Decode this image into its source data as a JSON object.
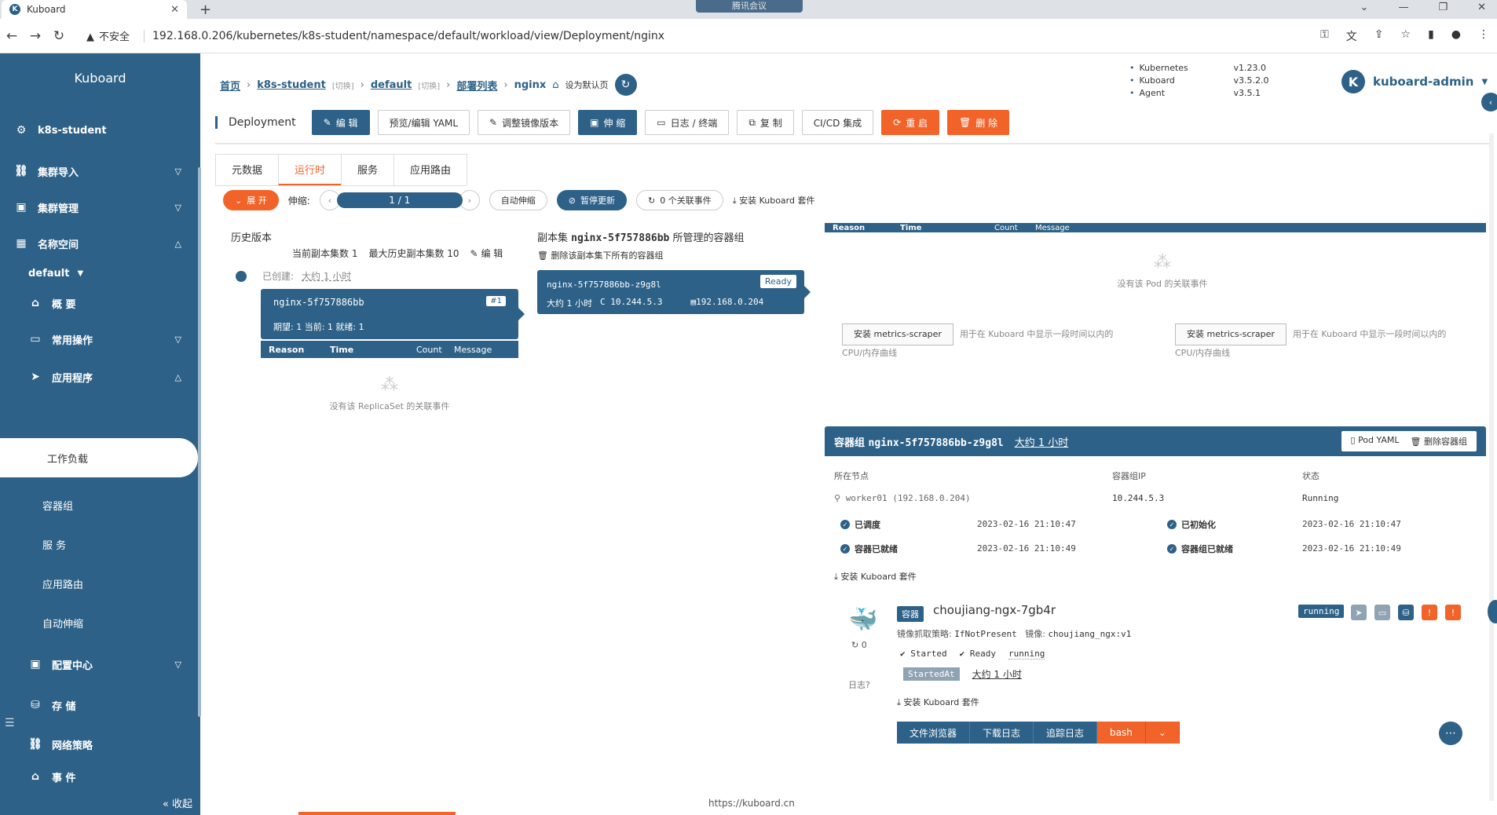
{
  "browser": {
    "tab_title": "Kuboard",
    "tab_favicon": "K",
    "meeting_label": "腾讯会议",
    "insecure_label": "不安全",
    "url": "192.168.0.206/kubernetes/k8s-student/namespace/default/workload/view/Deployment/nginx"
  },
  "sidebar": {
    "brand": "Kuboard",
    "cluster": "k8s-student",
    "items": {
      "import": "集群导入",
      "manage": "集群管理",
      "namespace": "名称空间",
      "ns_value": "default",
      "overview": "概 要",
      "common": "常用操作",
      "apps": "应用程序",
      "workload": "工作负载",
      "pods": "容器组",
      "services": "服 务",
      "ingress": "应用路由",
      "autoscale": "自动伸缩",
      "config": "配置中心",
      "storage": "存 储",
      "netpolicy": "网络策略",
      "events": "事 件"
    },
    "collapse": "« 收起"
  },
  "header": {
    "breadcrumb": {
      "home": "首页",
      "cluster": "k8s-student",
      "cluster_tag": "[切换]",
      "namespace": "default",
      "ns_tag": "[切换]",
      "deploy_list": "部署列表",
      "current": "nginx",
      "set_default": "设为默认页"
    },
    "versions": [
      {
        "k": "Kubernetes",
        "v": "v1.23.0"
      },
      {
        "k": "Kuboard",
        "v": "v3.5.2.0"
      },
      {
        "k": "Agent",
        "v": "v3.5.1"
      }
    ],
    "user": {
      "avatar": "K",
      "name": "kuboard-admin"
    }
  },
  "toolbar": {
    "kind": "Deployment",
    "edit": "编 辑",
    "yaml": "预览/编辑 YAML",
    "image": "调整镜像版本",
    "scale": "伸 缩",
    "logs": "日志 / 终端",
    "copy": "复 制",
    "cicd": "CI/CD 集成",
    "restart": "重 启",
    "delete": "删 除"
  },
  "tabs": [
    "元数据",
    "运行时",
    "服务",
    "应用路由"
  ],
  "runtime": {
    "expand": "展 开",
    "scale_label": "伸缩:",
    "scale_value": "1 / 1",
    "autoscale": "自动伸缩",
    "pause": "暂停更新",
    "events": "0 个关联事件",
    "install": "安装 Kuboard 套件"
  },
  "history": {
    "title": "历史版本",
    "current_replicas": "当前副本集数 1",
    "max_history": "最大历史副本集数 10",
    "edit": "编 辑",
    "created_label": "已创建:",
    "created_value": "大约 1 小时",
    "rs_name": "nginx-5f757886bb",
    "rs_badge": "#1",
    "rs_stats": "期望: 1  当前: 1  就绪: 1",
    "ev_cols": [
      "Reason",
      "Time",
      "Count",
      "Message"
    ],
    "empty": "没有该 ReplicaSet 的关联事件"
  },
  "podset": {
    "title_prefix": "副本集",
    "title_name": "nginx-5f757886bb",
    "title_suffix": "所管理的容器组",
    "delete_all": "删除该副本集下所有的容器组",
    "pod_name": "nginx-5f757886bb-z9g8l",
    "pod_ready": "Ready",
    "pod_age": "大约 1 小时",
    "pod_ip": "C 10.244.5.3",
    "host_ip": "192.168.0.204"
  },
  "pod_events": {
    "cols": [
      "Reason",
      "Time",
      "Count",
      "Message"
    ],
    "empty": "没有该 Pod 的关联事件",
    "metric_btn": "安装 metrics-scraper",
    "metric_desc": "用于在 Kuboard 中显示一段时间以内的CPU/内存曲线"
  },
  "pod": {
    "label": "容器组",
    "name": "nginx-5f757886bb-z9g8l",
    "age": "大约 1 小时",
    "yaml": "Pod YAML",
    "delete": "删除容器组",
    "node_label": "所在节点",
    "node_value": "worker01 (192.168.0.204)",
    "ip_label": "容器组IP",
    "ip_value": "10.244.5.3",
    "status_label": "状态",
    "status_value": "Running",
    "conditions": [
      {
        "name": "已调度",
        "time": "2023-02-16 21:10:47"
      },
      {
        "name": "已初始化",
        "time": "2023-02-16 21:10:47"
      },
      {
        "name": "容器已就绪",
        "time": "2023-02-16 21:10:49"
      },
      {
        "name": "容器组已就绪",
        "time": "2023-02-16 21:10:49"
      }
    ],
    "install": "安装 Kuboard 套件"
  },
  "container": {
    "tag": "容器",
    "name": "choujiang-ngx-7gb4r",
    "pull_label": "镜像抓取策略:",
    "pull_value": "IfNotPresent",
    "image_label": "镜像:",
    "image_value": "choujiang_ngx:v1",
    "restart": "0",
    "logs_label": "日志",
    "started": "Started",
    "ready": "Ready",
    "running": "running",
    "started_at_tag": "StartedAt",
    "started_at_value": "大约 1 小时",
    "state_badge": "running",
    "install": "安装 Kuboard 套件",
    "actions": [
      "文件浏览器",
      "下载日志",
      "追踪日志",
      "bash"
    ],
    "colors": {
      "primary": "#2d6187",
      "orange": "#f2632a"
    }
  },
  "footer": "https://kuboard.cn"
}
